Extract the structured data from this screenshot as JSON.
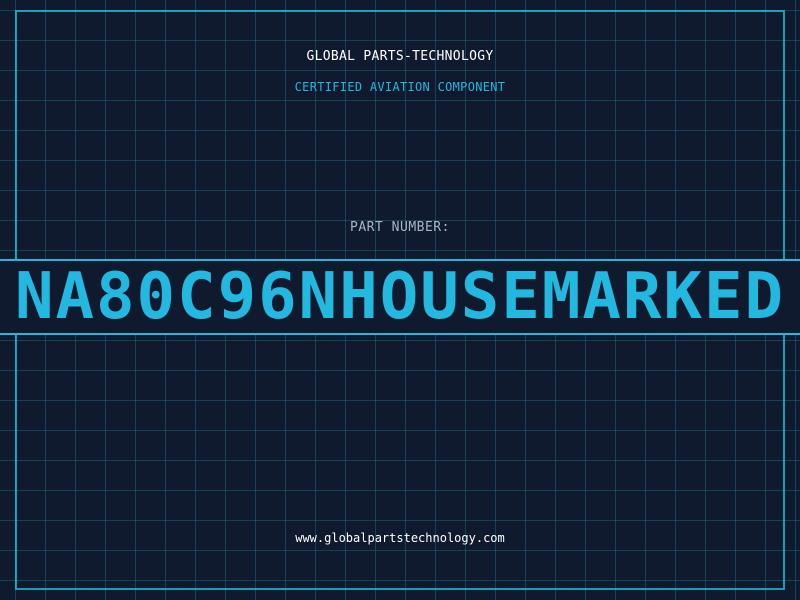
{
  "header": {
    "company": "GLOBAL PARTS-TECHNOLOGY",
    "subtitle": "CERTIFIED AVIATION COMPONENT"
  },
  "part": {
    "label": "PART NUMBER:",
    "number": "NA80C96NHOUSEMARKED"
  },
  "footer": {
    "website": "www.globalpartstechnology.com"
  },
  "colors": {
    "background": "#101a2e",
    "accent": "#22b8e0",
    "text": "#ffffff",
    "muted": "#a9b4c6"
  }
}
